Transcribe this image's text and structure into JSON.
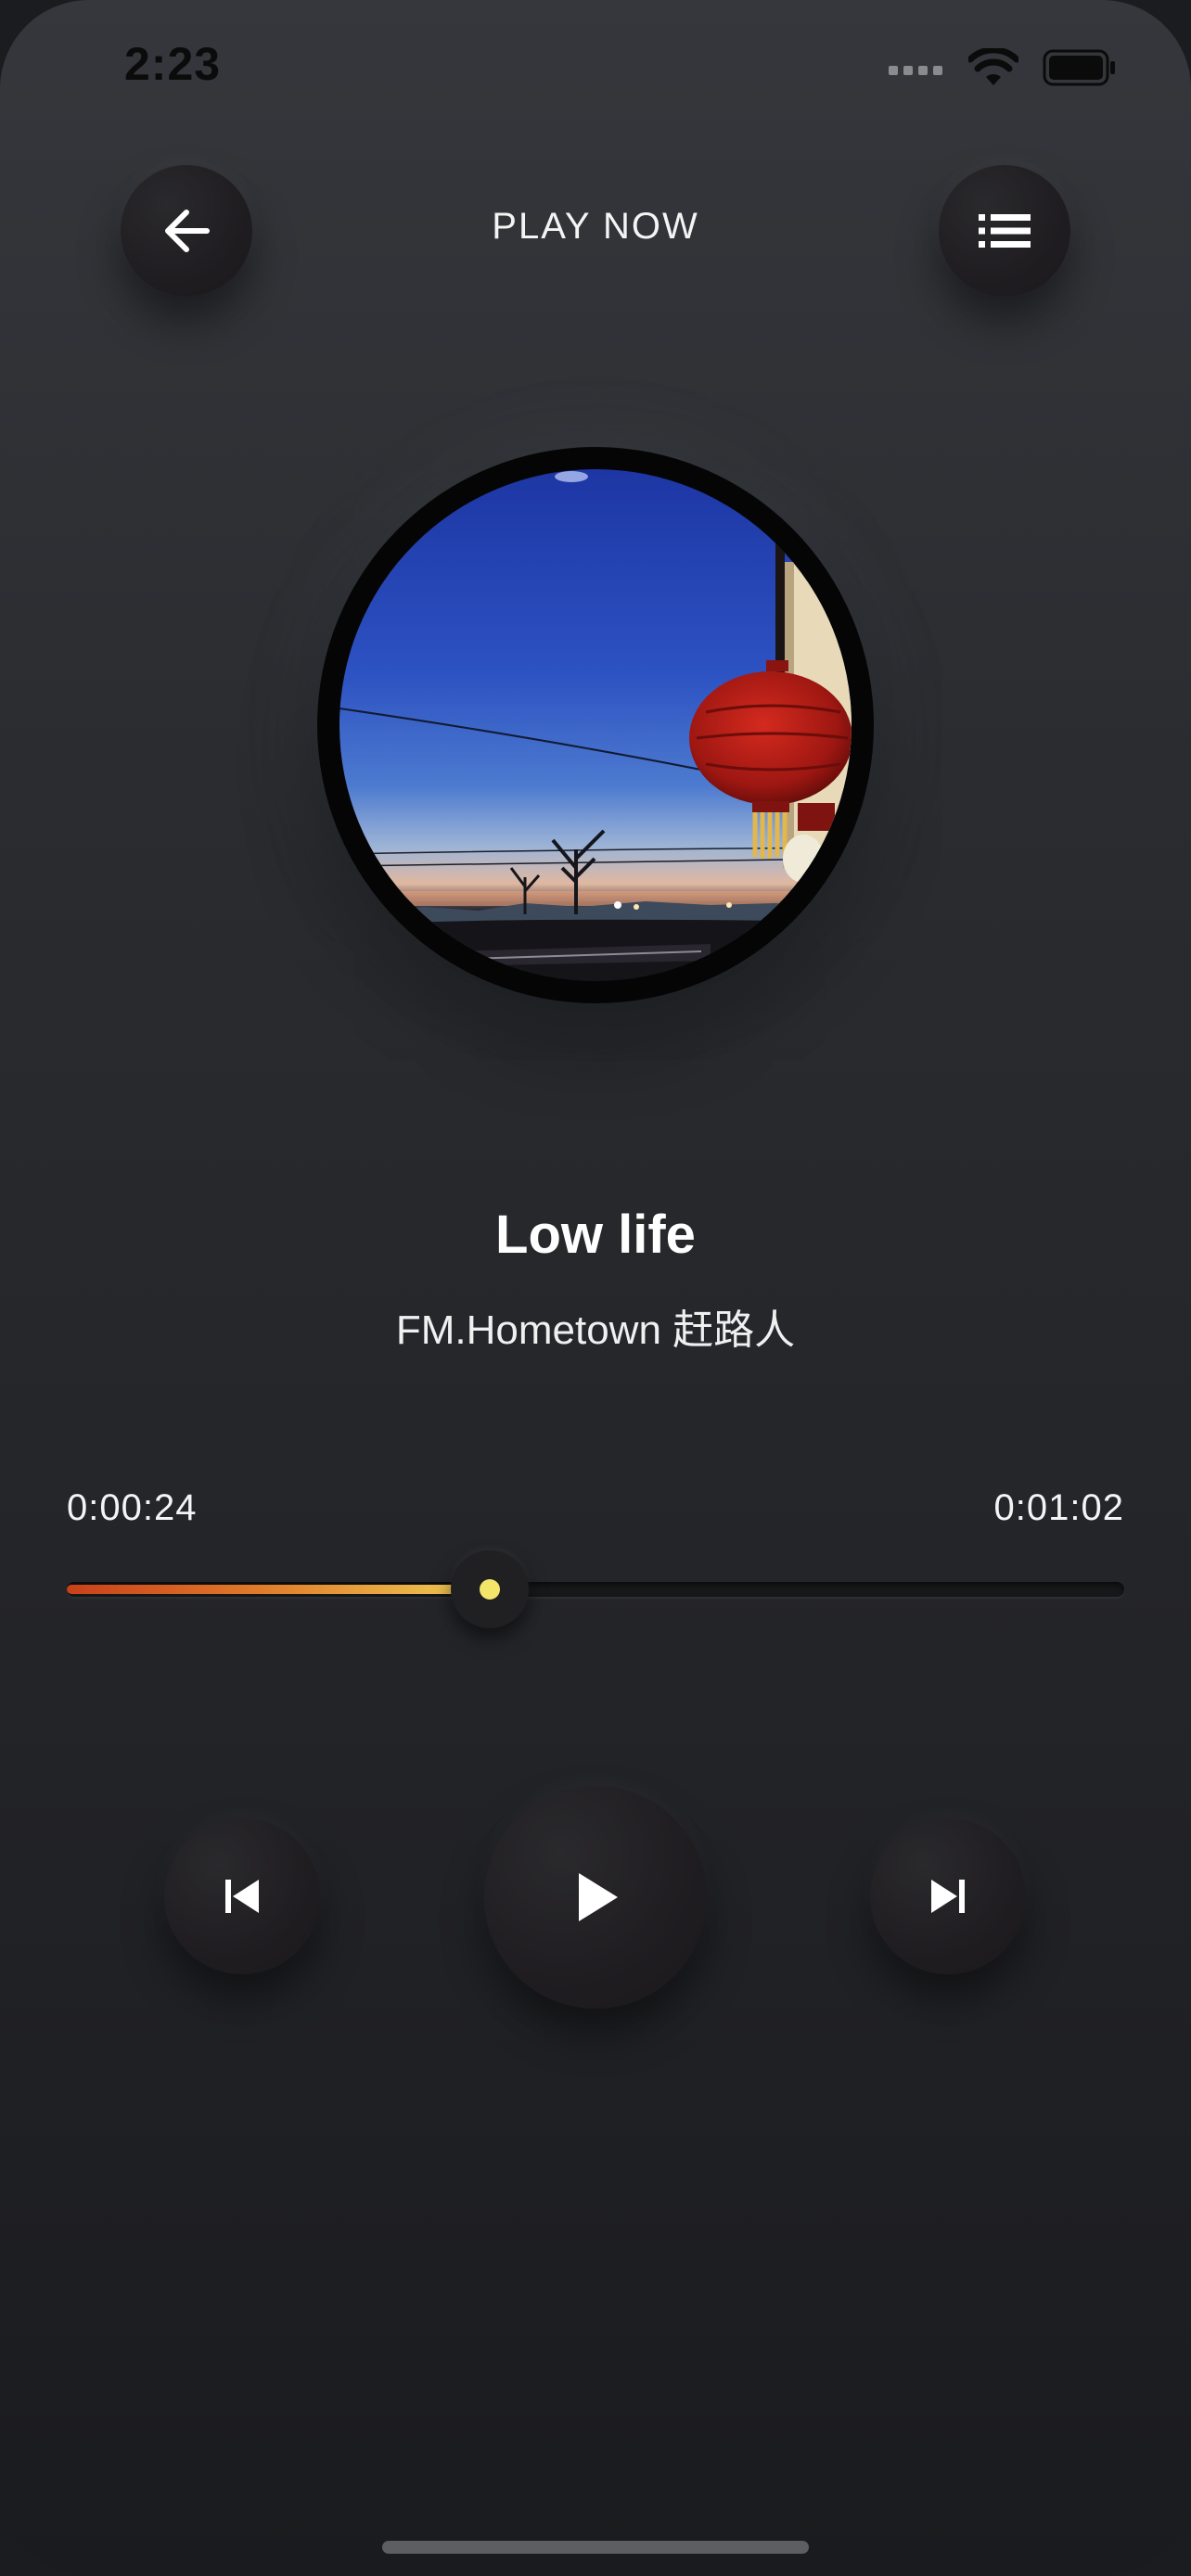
{
  "status_bar": {
    "time": "2:23"
  },
  "header": {
    "title": "PLAY NOW",
    "back_icon": "arrow-left-icon",
    "menu_icon": "list-icon"
  },
  "track": {
    "title": "Low life",
    "artist": "FM.Hometown 赶路人"
  },
  "progress": {
    "elapsed": "0:00:24",
    "total": "0:01:02",
    "fraction": 0.4
  },
  "controls": {
    "previous_icon": "skip-previous-icon",
    "play_icon": "play-icon",
    "next_icon": "skip-next-icon"
  },
  "colors": {
    "accent_start": "#c8401a",
    "accent_end": "#f0cf56",
    "thumb_dot": "#f3e46a"
  }
}
